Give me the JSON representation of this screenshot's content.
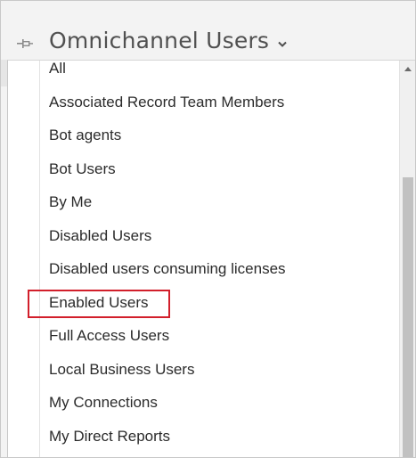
{
  "header": {
    "title": "Omnichannel Users",
    "pin_icon": "pin-icon",
    "chevron_icon": "chevron-down-icon"
  },
  "menu": {
    "items": [
      {
        "label": "All"
      },
      {
        "label": "Associated Record Team Members"
      },
      {
        "label": "Bot agents"
      },
      {
        "label": "Bot Users"
      },
      {
        "label": "By Me"
      },
      {
        "label": "Disabled Users"
      },
      {
        "label": "Disabled users consuming licenses"
      },
      {
        "label": "Enabled Users",
        "highlighted": true
      },
      {
        "label": "Full Access Users"
      },
      {
        "label": "Local Business Users"
      },
      {
        "label": "My Connections"
      },
      {
        "label": "My Direct Reports"
      }
    ]
  },
  "colors": {
    "highlight_border": "#d21f2b",
    "title_text": "#505050",
    "item_text": "#2b2b2b",
    "scroll_thumb": "#c1c1c1"
  }
}
